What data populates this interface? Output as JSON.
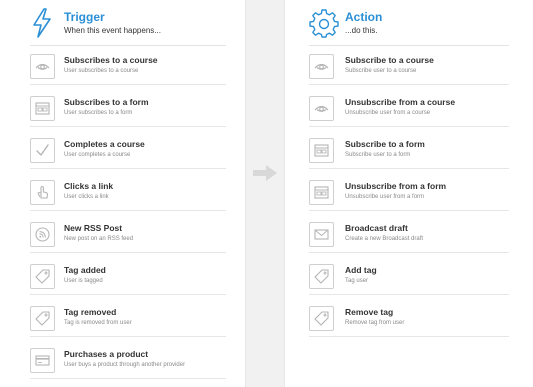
{
  "trigger": {
    "title": "Trigger",
    "subtitle": "When this event happens...",
    "items": [
      {
        "title": "Subscribes to a course",
        "desc": "User subscribes to a course",
        "icon": "course-eye-icon"
      },
      {
        "title": "Subscribes to a form",
        "desc": "User subscribes to a form",
        "icon": "form-icon"
      },
      {
        "title": "Completes a course",
        "desc": "User completes a course",
        "icon": "checkmark-icon"
      },
      {
        "title": "Clicks a link",
        "desc": "User clicks a link",
        "icon": "pointer-hand-icon"
      },
      {
        "title": "New RSS Post",
        "desc": "New post on an RSS feed",
        "icon": "rss-icon"
      },
      {
        "title": "Tag added",
        "desc": "User is tagged",
        "icon": "tag-icon"
      },
      {
        "title": "Tag removed",
        "desc": "Tag is removed from user",
        "icon": "tag-icon"
      },
      {
        "title": "Purchases a product",
        "desc": "User buys a product through another provider",
        "icon": "credit-card-icon"
      }
    ]
  },
  "action": {
    "title": "Action",
    "subtitle": "...do this.",
    "items": [
      {
        "title": "Subscribe to a course",
        "desc": "Subscribe user to a course",
        "icon": "course-eye-icon"
      },
      {
        "title": "Unsubscribe from a course",
        "desc": "Unsubscribe user from a course",
        "icon": "course-eye-icon"
      },
      {
        "title": "Subscribe to a form",
        "desc": "Subscribe user to a form",
        "icon": "form-icon"
      },
      {
        "title": "Unsubscribe from a form",
        "desc": "Unsubscribe user from a form",
        "icon": "form-icon"
      },
      {
        "title": "Broadcast draft",
        "desc": "Create a new Broadcast draft",
        "icon": "envelope-icon"
      },
      {
        "title": "Add tag",
        "desc": "Tag user",
        "icon": "tag-icon"
      },
      {
        "title": "Remove tag",
        "desc": "Remove tag from user",
        "icon": "tag-icon"
      }
    ]
  },
  "colors": {
    "accent": "#2b8fd6",
    "icon_gray": "#b5b5b5",
    "divider": "#e6e6e6",
    "gap_bg": "#f1f1f1"
  }
}
